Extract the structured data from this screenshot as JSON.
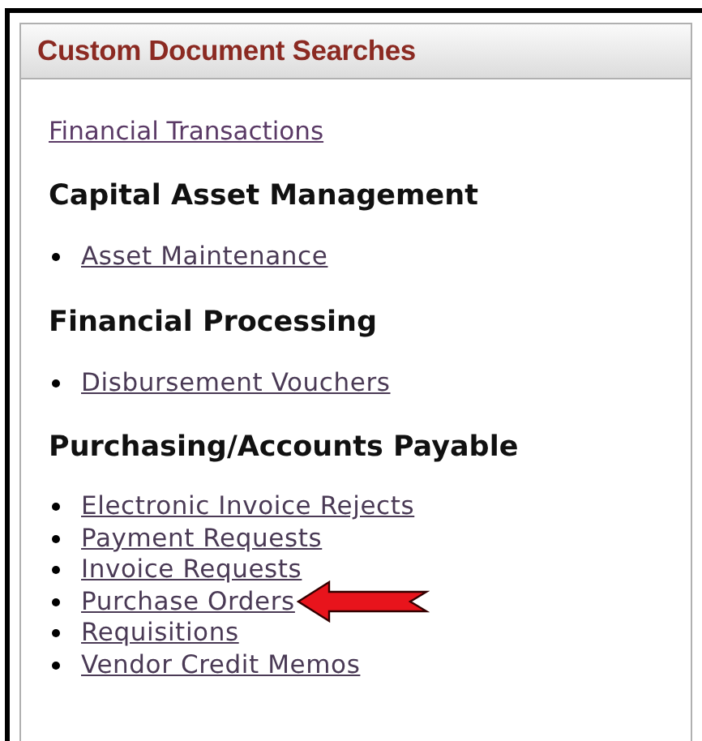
{
  "panel": {
    "title": "Custom Document Searches"
  },
  "top_link": "Financial Transactions",
  "sections": [
    {
      "heading": "Capital Asset Management",
      "links": [
        {
          "label": "Asset Maintenance",
          "highlighted": false
        }
      ]
    },
    {
      "heading": "Financial Processing",
      "links": [
        {
          "label": "Disbursement Vouchers",
          "highlighted": false
        }
      ]
    },
    {
      "heading": "Purchasing/Accounts Payable",
      "links": [
        {
          "label": "Electronic Invoice Rejects",
          "highlighted": false
        },
        {
          "label": "Payment Requests",
          "highlighted": false
        },
        {
          "label": "Invoice Requests",
          "highlighted": false
        },
        {
          "label": "Purchase Orders",
          "highlighted": true
        },
        {
          "label": "Requisitions",
          "highlighted": false
        },
        {
          "label": "Vendor Credit Memos",
          "highlighted": false
        }
      ]
    }
  ]
}
